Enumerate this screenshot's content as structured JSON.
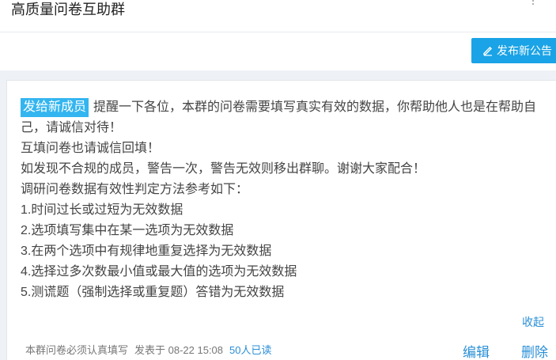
{
  "header": {
    "group_title": "高质量问卷互助群"
  },
  "toolbar": {
    "publish_label": "发布新公告"
  },
  "announcement": {
    "recipient_tag": "发给新成员",
    "lines": [
      "提醒一下各位，本群的问卷需要填写真实有效的数据，你帮助他人也是在帮助自己，请诚信对待！",
      "互填问卷也请诚信回填！",
      "如发现不合规的成员，警告一次，警告无效则移出群聊。谢谢大家配合！",
      "调研问卷数据有效性判定方法参考如下：",
      "1.时间过长或过短为无效数据",
      "2.选项填写集中在某一选项为无效数据",
      "3.在两个选项中有规律地重复选择为无效数据",
      "4.选择过多次数最小值或最大值的选项为无效数据",
      "5.测谎题（强制选择或重复题）答错为无效数据"
    ],
    "collapse_label": "收起",
    "footer": {
      "author": "本群问卷必须认真填写",
      "posted_at": "发表于 08-22 15:08",
      "read_count": "50人已读"
    },
    "edit_label": "编辑",
    "delete_label": "删除"
  },
  "colors": {
    "accent": "#1aa3e6",
    "link": "#2a8fd6",
    "tag": "#33b5f0"
  }
}
